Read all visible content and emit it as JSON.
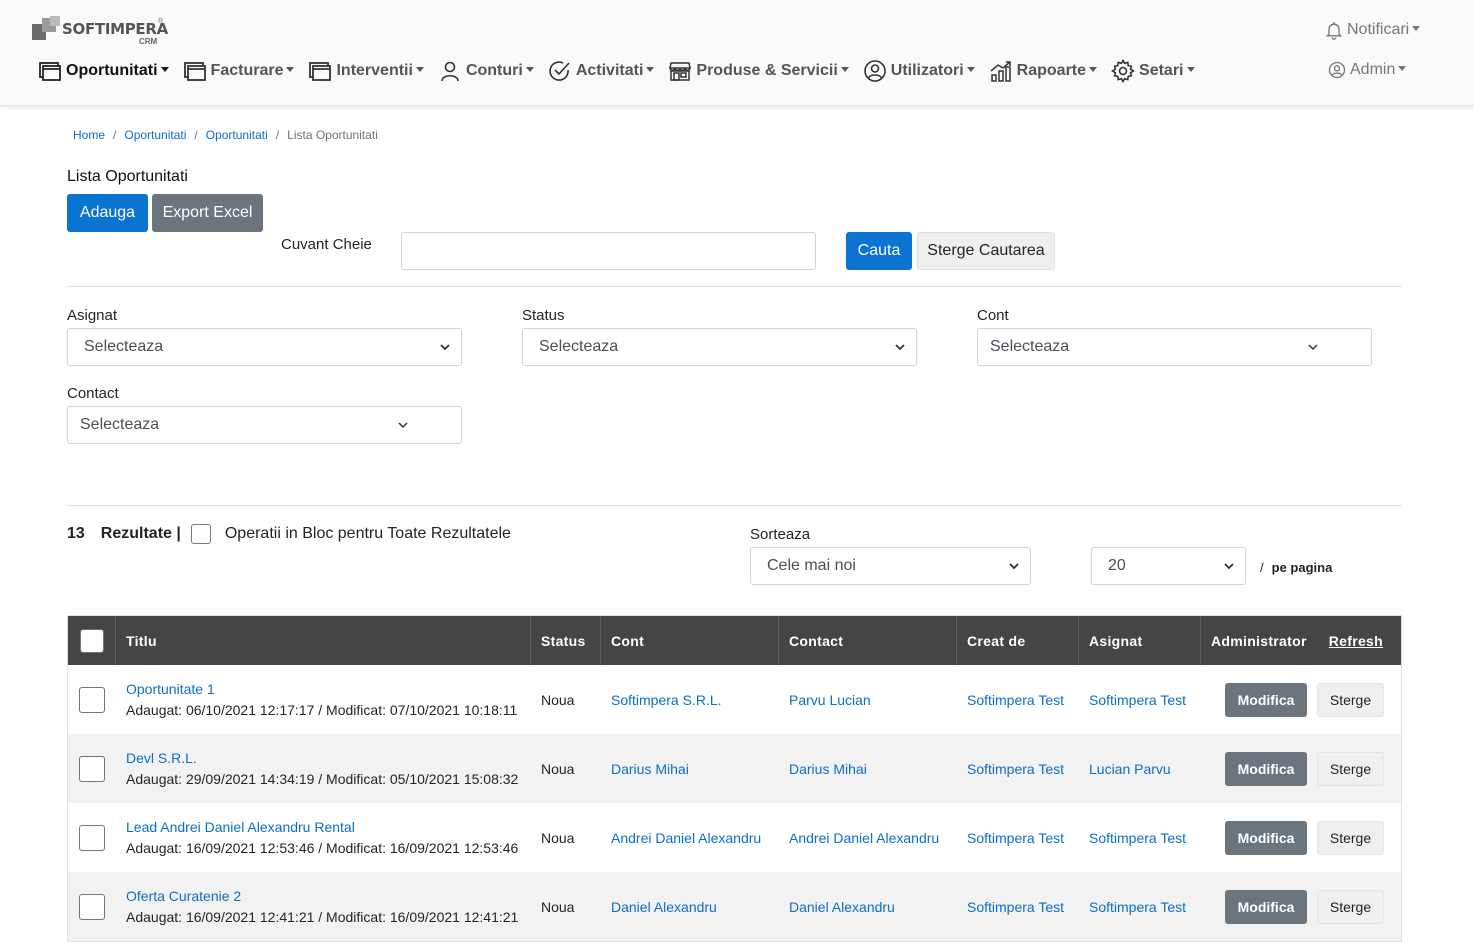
{
  "logo": {
    "text": "SOFTIMPERA",
    "sub": "CRM",
    "reg": "®"
  },
  "nav": [
    {
      "label": "Oportunitati",
      "icon": "window-icon"
    },
    {
      "label": "Facturare",
      "icon": "window-icon"
    },
    {
      "label": "Interventii",
      "icon": "window-icon"
    },
    {
      "label": "Conturi",
      "icon": "user-icon"
    },
    {
      "label": "Activitati",
      "icon": "check-circle-icon"
    },
    {
      "label": "Produse & Servicii",
      "icon": "shop-icon"
    },
    {
      "label": "Utilizatori",
      "icon": "user-circle-icon"
    },
    {
      "label": "Rapoarte",
      "icon": "graph-icon"
    },
    {
      "label": "Setari",
      "icon": "gear-icon"
    }
  ],
  "header": {
    "notifications": "Notificari",
    "admin": "Admin"
  },
  "breadcrumb": [
    "Home",
    "Oportunitati",
    "Oportunitati",
    "Lista Oportunitati"
  ],
  "page": {
    "title": "Lista Oportunitati",
    "add": "Adauga",
    "export": "Export Excel",
    "keyword_label": "Cuvant Cheie",
    "keyword_value": "",
    "search": "Cauta",
    "clear": "Sterge Cautarea"
  },
  "filters": {
    "asignat": {
      "label": "Asignat",
      "value": "Selecteaza"
    },
    "status": {
      "label": "Status",
      "value": "Selecteaza"
    },
    "cont": {
      "label": "Cont",
      "value": "Selecteaza"
    },
    "contact": {
      "label": "Contact",
      "value": "Selecteaza"
    }
  },
  "results": {
    "count": "13",
    "label": "Rezultate |",
    "bulk": "Operatii in Bloc pentru Toate Rezultatele",
    "sort_label": "Sorteaza",
    "sort_value": "Cele mai noi",
    "per_page_value": "20",
    "per_page_sep": "/",
    "per_page_label": "pe pagina"
  },
  "table": {
    "headers": {
      "titlu": "Titlu",
      "status": "Status",
      "cont": "Cont",
      "contact": "Contact",
      "creat": "Creat de",
      "asignat": "Asignat",
      "admin": "Administrator",
      "refresh": "Refresh"
    },
    "edit": "Modifica",
    "delete": "Sterge",
    "rows": [
      {
        "title": "Oportunitate 1",
        "dates": "Adaugat: 06/10/2021 12:17:17 / Modificat: 07/10/2021 10:18:11",
        "status": "Noua",
        "cont": "Softimpera S.R.L.",
        "contact": "Parvu Lucian",
        "creat": "Softimpera Test",
        "asignat": "Softimpera Test"
      },
      {
        "title": "Devl S.R.L.",
        "dates": "Adaugat: 29/09/2021 14:34:19 / Modificat: 05/10/2021 15:08:32",
        "status": "Noua",
        "cont": "Darius Mihai",
        "contact": "Darius Mihai",
        "creat": "Softimpera Test",
        "asignat": "Lucian Parvu"
      },
      {
        "title": "Lead Andrei Daniel Alexandru Rental",
        "dates": "Adaugat: 16/09/2021 12:53:46 / Modificat: 16/09/2021 12:53:46",
        "status": "Noua",
        "cont": "Andrei Daniel Alexandru",
        "contact": "Andrei Daniel Alexandru",
        "creat": "Softimpera Test",
        "asignat": "Softimpera Test"
      },
      {
        "title": "Oferta Curatenie 2",
        "dates": "Adaugat: 16/09/2021 12:41:21 / Modificat: 16/09/2021 12:41:21",
        "status": "Noua",
        "cont": "Daniel Alexandru",
        "contact": "Daniel Alexandru",
        "creat": "Softimpera Test",
        "asignat": "Softimpera Test"
      }
    ]
  }
}
